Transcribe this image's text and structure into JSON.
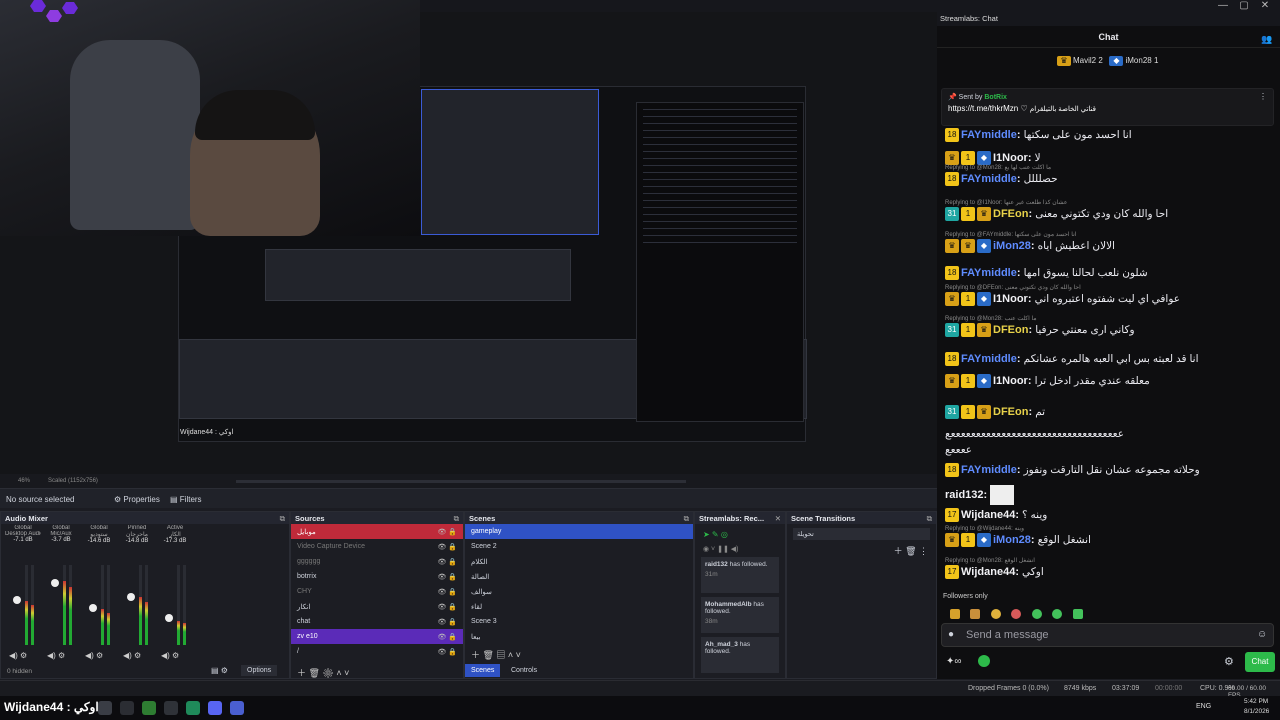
{
  "window": {
    "title": "Streamlabs: Chat",
    "controls": [
      "—",
      "▢",
      "✕"
    ]
  },
  "preview": {
    "nested_caption": "Wijdane44 : اوكي",
    "zoom_label": "46%",
    "scale_label": "Scaled (1152x756)"
  },
  "source_bar": {
    "status": "No source selected",
    "properties": "Properties",
    "filters": "Filters"
  },
  "audio_mixer": {
    "title": "Audio Mixer",
    "channels": [
      {
        "scope": "Global",
        "name": "Desktop Audio 2",
        "db": "-7.1 dB",
        "level": 0.55
      },
      {
        "scope": "Global",
        "name": "Mic/Aux",
        "db": "-3.7 dB",
        "level": 0.8
      },
      {
        "scope": "Global",
        "name": "ستوديو",
        "db": "-14.6 dB",
        "level": 0.45
      },
      {
        "scope": "Pinned",
        "name": "ماحرجان",
        "db": "-14.8 dB",
        "level": 0.6
      },
      {
        "scope": "Active",
        "name": "الكار",
        "db": "-17.3 dB",
        "level": 0.3
      }
    ],
    "hidden": "0 hidden",
    "options": "Options"
  },
  "sources": {
    "title": "Sources",
    "items": [
      {
        "label": "موبايل",
        "state": "red"
      },
      {
        "label": "Video Capture Device",
        "state": "dim"
      },
      {
        "label": "gggggg",
        "state": "dim"
      },
      {
        "label": "botrrix",
        "state": "normal"
      },
      {
        "label": "CHY",
        "state": "dim"
      },
      {
        "label": "انكار",
        "state": "normal"
      },
      {
        "label": "chat",
        "state": "normal"
      },
      {
        "label": "zv e10",
        "state": "purple"
      },
      {
        "label": "/",
        "state": "normal"
      }
    ]
  },
  "scenes": {
    "title": "Scenes",
    "items": [
      "gameplay",
      "Scene 2",
      "الكلام",
      "الصالة",
      "سوالف",
      "لقاء",
      "Scene 3",
      "بيعا"
    ],
    "tabs": [
      "Scenes",
      "Controls"
    ]
  },
  "recent_events": {
    "title": "Streamlabs: Rec...",
    "events": [
      {
        "name": "raid132",
        "text": "has followed.",
        "time": "31m"
      },
      {
        "name": "MohammedAlb",
        "text": "has followed.",
        "time": "38m"
      },
      {
        "name": "Ah_mad_3",
        "text": "has followed.",
        "time": ""
      }
    ]
  },
  "transitions": {
    "title": "Scene Transitions",
    "value": "تحويلة"
  },
  "chat": {
    "header": "Chat",
    "top_viewers": [
      {
        "name": "Mavil2",
        "count": "2"
      },
      {
        "name": "iMon28",
        "count": "1"
      }
    ],
    "pinned": {
      "sent_by": "Sent by",
      "sender": "BotRix",
      "link": "https://t.me/thkrMzn",
      "text": "قناتي الخاصة بالتيلقرام"
    },
    "messages": [
      {
        "reply": "",
        "badges": [
          "18"
        ],
        "user": "FAYmiddle",
        "user_color": "blue",
        "text": "انا احسد مون على سكتها"
      },
      {
        "reply": "",
        "badges": [
          "♛",
          "1",
          "◆"
        ],
        "user": "I1Noor",
        "user_color": "white",
        "text": "لا"
      },
      {
        "reply": "Replying to @Mon28: ما اكلت عنب لها يع",
        "badges": [
          "18"
        ],
        "user": "FAYmiddle",
        "user_color": "blue",
        "text": "حصلللل"
      },
      {
        "reply": "Replying to @I1Noor: عشان كذا طلعت غير عنها",
        "badges": [
          "31",
          "1",
          "♛"
        ],
        "user": "DFEon",
        "user_color": "yellow",
        "text": "احا والله كان ودي تكتوني معنى"
      },
      {
        "reply": "Replying to @FAYmiddle: انا احسد مون على سكتها",
        "badges": [
          "♛",
          "♛",
          "◆"
        ],
        "user": "iMon28",
        "user_color": "blue",
        "text": "الالان اعطيش اياه"
      },
      {
        "reply": "",
        "badges": [
          "18"
        ],
        "user": "FAYmiddle",
        "user_color": "blue",
        "text": "شلون نلعب لحالنا يسوق امها"
      },
      {
        "reply": "Replying to @DFEon: احا والله كان ودي تكتوني معنى",
        "badges": [
          "♛",
          "1",
          "◆"
        ],
        "user": "I1Noor",
        "user_color": "white",
        "text": "عوافي اي ليت شفتوه اعتبروه اني"
      },
      {
        "reply": "Replying to @Mon28: ما اكلت عنب",
        "badges": [
          "31",
          "1",
          "♛"
        ],
        "user": "DFEon",
        "user_color": "yellow",
        "text": "وكاني ارى معنتي حرفيا"
      },
      {
        "reply": "",
        "badges": [
          "18"
        ],
        "user": "FAYmiddle",
        "user_color": "blue",
        "text": "انا قد لعبته بس ابي العبه هالمره عشانكم"
      },
      {
        "reply": "",
        "badges": [
          "♛",
          "1",
          "◆"
        ],
        "user": "I1Noor",
        "user_color": "white",
        "text": "معلقه عندي مقدر ادخل ترا"
      },
      {
        "reply": "",
        "badges": [
          "31",
          "1",
          "♛"
        ],
        "user": "DFEon",
        "user_color": "yellow",
        "text": "تم"
      },
      {
        "reply": "",
        "badges": [],
        "user": "",
        "user_color": "white",
        "text": "ععععععععععععععععععععععععععععععععععع"
      },
      {
        "reply": "",
        "badges": [],
        "user": "",
        "user_color": "white",
        "text": "ععععع"
      },
      {
        "reply": "",
        "badges": [
          "18"
        ],
        "user": "FAYmiddle",
        "user_color": "blue",
        "text": "وحلاته مجموعه عشان نقل التارقت ونفوز"
      },
      {
        "reply": "",
        "badges": [],
        "user": "raid132",
        "user_color": "white",
        "text": ""
      },
      {
        "reply": "",
        "badges": [
          "17"
        ],
        "user": "Wijdane44",
        "user_color": "white",
        "text": "وينه ؟"
      },
      {
        "reply": "Replying to @Wijdane44: وينه",
        "badges": [
          "♛",
          "1",
          "◆"
        ],
        "user": "iMon28",
        "user_color": "blue",
        "text": "انشغل الوقع"
      },
      {
        "reply": "Replying to @Mon28: انشغل الوقع",
        "badges": [
          "17"
        ],
        "user": "Wijdane44",
        "user_color": "white",
        "text": "اوكي"
      }
    ],
    "followers_only": "Followers only",
    "input_placeholder": "Send a message",
    "send_label": "Chat"
  },
  "status_bar": {
    "dropped": "Dropped Frames 0 (0.0%)",
    "kbps": "8749 kbps",
    "time_live": "03:37:09",
    "time_rec": "00:00:00",
    "cpu": "CPU: 0.9%",
    "fps": "60.00 / 60.00 FPS"
  },
  "taskbar": {
    "caption": "Wijdane44 : اوكي",
    "lang": "ENG",
    "time": "5:42 PM",
    "date": "8/1/2026"
  },
  "colors": {
    "accent_green": "#2dba4a",
    "selection_red": "#c02a3a",
    "selection_purple": "#5b2bb8",
    "selection_blue": "#2f52c5",
    "user_blue": "#5f8cff"
  }
}
